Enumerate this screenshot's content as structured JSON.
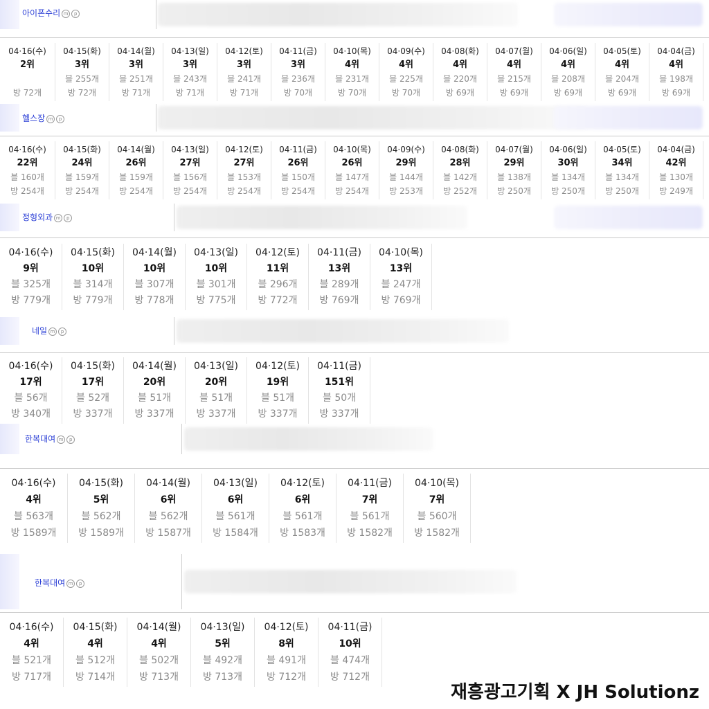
{
  "sections": [
    {
      "keyword": "아이폰수리",
      "badge_m": "m",
      "badge_p": "p",
      "days": [
        {
          "date": "04·16(수)",
          "rank": "2위",
          "blog": "",
          "place": "방 72개"
        },
        {
          "date": "04·15(화)",
          "rank": "3위",
          "blog": "블 255개",
          "place": "방 72개"
        },
        {
          "date": "04·14(월)",
          "rank": "3위",
          "blog": "블 251개",
          "place": "방 71개"
        },
        {
          "date": "04·13(일)",
          "rank": "3위",
          "blog": "블 243개",
          "place": "방 71개"
        },
        {
          "date": "04·12(토)",
          "rank": "3위",
          "blog": "블 241개",
          "place": "방 71개"
        },
        {
          "date": "04·11(금)",
          "rank": "3위",
          "blog": "블 236개",
          "place": "방 70개"
        },
        {
          "date": "04·10(목)",
          "rank": "4위",
          "blog": "블 231개",
          "place": "방 70개"
        },
        {
          "date": "04·09(수)",
          "rank": "4위",
          "blog": "블 225개",
          "place": "방 70개"
        },
        {
          "date": "04·08(화)",
          "rank": "4위",
          "blog": "블 220개",
          "place": "방 69개"
        },
        {
          "date": "04·07(월)",
          "rank": "4위",
          "blog": "블 215개",
          "place": "방 69개"
        },
        {
          "date": "04·06(일)",
          "rank": "4위",
          "blog": "블 208개",
          "place": "방 69개"
        },
        {
          "date": "04·05(토)",
          "rank": "4위",
          "blog": "블 204개",
          "place": "방 69개"
        },
        {
          "date": "04·04(금)",
          "rank": "4위",
          "blog": "블 198개",
          "place": "방 69개"
        }
      ]
    },
    {
      "keyword": "헬스장",
      "badge_m": "m",
      "badge_p": "p",
      "days": [
        {
          "date": "04·16(수)",
          "rank": "22위",
          "blog": "블 160개",
          "place": "방 254개"
        },
        {
          "date": "04·15(화)",
          "rank": "24위",
          "blog": "블 159개",
          "place": "방 254개"
        },
        {
          "date": "04·14(월)",
          "rank": "26위",
          "blog": "블 159개",
          "place": "방 254개"
        },
        {
          "date": "04·13(일)",
          "rank": "27위",
          "blog": "블 156개",
          "place": "방 254개"
        },
        {
          "date": "04·12(토)",
          "rank": "27위",
          "blog": "블 153개",
          "place": "방 254개"
        },
        {
          "date": "04·11(금)",
          "rank": "26위",
          "blog": "블 150개",
          "place": "방 254개"
        },
        {
          "date": "04·10(목)",
          "rank": "26위",
          "blog": "블 147개",
          "place": "방 254개"
        },
        {
          "date": "04·09(수)",
          "rank": "29위",
          "blog": "블 144개",
          "place": "방 253개"
        },
        {
          "date": "04·08(화)",
          "rank": "28위",
          "blog": "블 142개",
          "place": "방 252개"
        },
        {
          "date": "04·07(월)",
          "rank": "29위",
          "blog": "블 138개",
          "place": "방 250개"
        },
        {
          "date": "04·06(일)",
          "rank": "30위",
          "blog": "블 134개",
          "place": "방 250개"
        },
        {
          "date": "04·05(토)",
          "rank": "34위",
          "blog": "블 134개",
          "place": "방 250개"
        },
        {
          "date": "04·04(금)",
          "rank": "42위",
          "blog": "블 130개",
          "place": "방 249개"
        }
      ]
    },
    {
      "keyword": "정형외과",
      "badge_m": "m",
      "badge_p": "p",
      "days": [
        {
          "date": "04·16(수)",
          "rank": "9위",
          "blog": "블 325개",
          "place": "방 779개"
        },
        {
          "date": "04·15(화)",
          "rank": "10위",
          "blog": "블 314개",
          "place": "방 779개"
        },
        {
          "date": "04·14(월)",
          "rank": "10위",
          "blog": "블 307개",
          "place": "방 778개"
        },
        {
          "date": "04·13(일)",
          "rank": "10위",
          "blog": "블 301개",
          "place": "방 775개"
        },
        {
          "date": "04·12(토)",
          "rank": "11위",
          "blog": "블 296개",
          "place": "방 772개"
        },
        {
          "date": "04·11(금)",
          "rank": "13위",
          "blog": "블 289개",
          "place": "방 769개"
        },
        {
          "date": "04·10(목)",
          "rank": "13위",
          "blog": "블 247개",
          "place": "방 769개"
        }
      ]
    },
    {
      "keyword": "네일",
      "badge_m": "m",
      "badge_p": "p",
      "days": [
        {
          "date": "04·16(수)",
          "rank": "17위",
          "blog": "블 56개",
          "place": "방 340개"
        },
        {
          "date": "04·15(화)",
          "rank": "17위",
          "blog": "블 52개",
          "place": "방 337개"
        },
        {
          "date": "04·14(월)",
          "rank": "20위",
          "blog": "블 51개",
          "place": "방 337개"
        },
        {
          "date": "04·13(일)",
          "rank": "20위",
          "blog": "블 51개",
          "place": "방 337개"
        },
        {
          "date": "04·12(토)",
          "rank": "19위",
          "blog": "블 51개",
          "place": "방 337개"
        },
        {
          "date": "04·11(금)",
          "rank": "151위",
          "blog": "블 50개",
          "place": "방 337개"
        }
      ]
    },
    {
      "keyword": "한복대여",
      "badge_m": "m",
      "badge_p": "p",
      "days": [
        {
          "date": "04·16(수)",
          "rank": "4위",
          "blog": "블 563개",
          "place": "방 1589개"
        },
        {
          "date": "04·15(화)",
          "rank": "5위",
          "blog": "블 562개",
          "place": "방 1589개"
        },
        {
          "date": "04·14(월)",
          "rank": "6위",
          "blog": "블 562개",
          "place": "방 1587개"
        },
        {
          "date": "04·13(일)",
          "rank": "6위",
          "blog": "블 561개",
          "place": "방 1584개"
        },
        {
          "date": "04·12(토)",
          "rank": "6위",
          "blog": "블 561개",
          "place": "방 1583개"
        },
        {
          "date": "04·11(금)",
          "rank": "7위",
          "blog": "블 561개",
          "place": "방 1582개"
        },
        {
          "date": "04·10(목)",
          "rank": "7위",
          "blog": "블 560개",
          "place": "방 1582개"
        }
      ]
    },
    {
      "keyword": "한복대여",
      "badge_m": "m",
      "badge_p": "p",
      "days": [
        {
          "date": "04·16(수)",
          "rank": "4위",
          "blog": "블 521개",
          "place": "방 717개"
        },
        {
          "date": "04·15(화)",
          "rank": "4위",
          "blog": "블 512개",
          "place": "방 714개"
        },
        {
          "date": "04·14(월)",
          "rank": "4위",
          "blog": "블 502개",
          "place": "방 713개"
        },
        {
          "date": "04·13(일)",
          "rank": "5위",
          "blog": "블 492개",
          "place": "방 713개"
        },
        {
          "date": "04·12(토)",
          "rank": "8위",
          "blog": "블 491개",
          "place": "방 712개"
        },
        {
          "date": "04·11(금)",
          "rank": "10위",
          "blog": "블 474개",
          "place": "방 712개"
        }
      ]
    }
  ],
  "watermark": "재흥광고기획 X JH Solutionz"
}
